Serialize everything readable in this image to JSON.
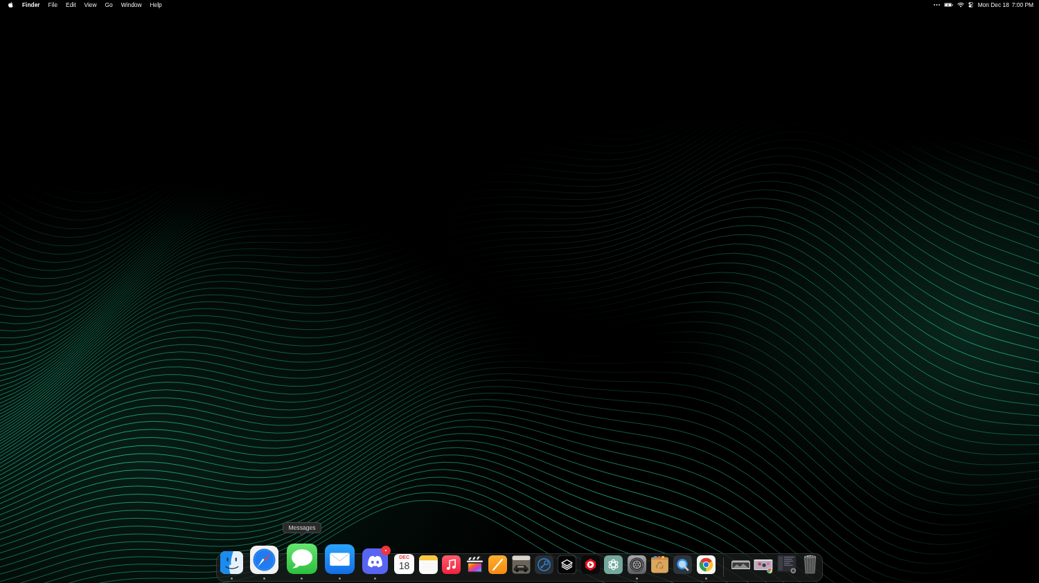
{
  "menu_bar": {
    "menus": [
      {
        "kind": "app",
        "label": "Finder"
      },
      {
        "kind": "menu",
        "label": "File"
      },
      {
        "kind": "menu",
        "label": "Edit"
      },
      {
        "kind": "menu",
        "label": "View"
      },
      {
        "kind": "menu",
        "label": "Go"
      },
      {
        "kind": "menu",
        "label": "Window"
      },
      {
        "kind": "menu",
        "label": "Help"
      }
    ],
    "clock": {
      "date": "Mon Dec 18",
      "time": "7:00 PM"
    }
  },
  "dock": {
    "apps": [
      {
        "running": true,
        "badge": false
      },
      {
        "running": true,
        "badge": false
      },
      {
        "running": true,
        "badge": false,
        "tooltip": "Messages"
      },
      {
        "running": true,
        "badge": false
      },
      {
        "running": true,
        "badge": true
      },
      {
        "running": false,
        "badge": false,
        "month": "DEC",
        "day": "18"
      },
      {
        "running": false,
        "badge": false
      },
      {
        "running": false,
        "badge": false
      },
      {
        "running": false,
        "badge": false
      },
      {
        "running": false,
        "badge": false
      },
      {
        "running": false,
        "badge": false
      },
      {
        "running": false,
        "badge": false
      },
      {
        "running": false,
        "badge": false
      },
      {
        "running": false,
        "badge": false
      },
      {
        "running": false,
        "badge": false
      },
      {
        "running": true,
        "badge": false
      },
      {
        "running": false,
        "badge": false
      },
      {
        "running": false,
        "badge": false
      },
      {
        "running": true,
        "badge": false
      }
    ],
    "others": [
      {
        "kind": "window"
      },
      {
        "kind": "window"
      },
      {
        "kind": "window"
      },
      {
        "kind": "trash"
      }
    ]
  }
}
